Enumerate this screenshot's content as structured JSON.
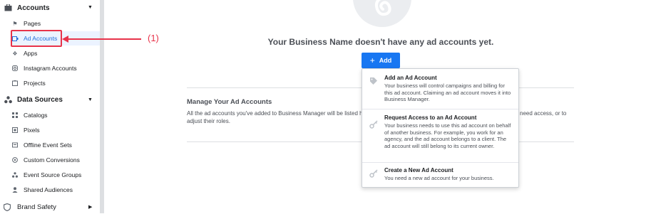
{
  "sidebar": {
    "accounts_header": "Accounts",
    "accounts_items": [
      {
        "label": "Pages",
        "icon": "flag-icon"
      },
      {
        "label": "Ad Accounts",
        "icon": "ad-account-icon"
      },
      {
        "label": "Apps",
        "icon": "apps-icon"
      },
      {
        "label": "Instagram Accounts",
        "icon": "instagram-icon"
      },
      {
        "label": "Projects",
        "icon": "projects-icon"
      }
    ],
    "data_sources_header": "Data Sources",
    "data_sources_items": [
      {
        "label": "Catalogs",
        "icon": "catalog-icon"
      },
      {
        "label": "Pixels",
        "icon": "pixel-icon"
      },
      {
        "label": "Offline Event Sets",
        "icon": "offline-events-icon"
      },
      {
        "label": "Custom Conversions",
        "icon": "custom-conversions-icon"
      },
      {
        "label": "Event Source Groups",
        "icon": "event-groups-icon"
      },
      {
        "label": "Shared Audiences",
        "icon": "audiences-icon"
      }
    ],
    "brand_safety": "Brand Safety"
  },
  "annotation": "(1)",
  "main": {
    "headline": "Your Business Name doesn't have any ad accounts yet.",
    "add_button": "Add",
    "manage_title": "Manage Your Ad Accounts",
    "manage_desc_line1": "All the ad accounts you've added to Business Manager will be listed he",
    "manage_desc_line1_end": "need access, or to",
    "manage_desc_line2": "adjust their roles."
  },
  "dropdown": {
    "items": [
      {
        "title": "Add an Ad Account",
        "desc": "Your business will control campaigns and billing for this ad account. Claiming an ad account moves it into Business Manager.",
        "icon": "tag-icon"
      },
      {
        "title": "Request Access to an Ad Account",
        "desc": "Your business needs to use this ad account on behalf of another business. For example, you work for an agency, and the ad account belongs to a client. The ad account will still belong to its current owner.",
        "icon": "key-icon"
      },
      {
        "title": "Create a New Ad Account",
        "desc": "You need a new ad account for your business.",
        "icon": "key-icon"
      }
    ]
  },
  "colors": {
    "accent": "#1877f2",
    "annotation": "#e8334a",
    "active_bg": "#ecf3ff"
  }
}
